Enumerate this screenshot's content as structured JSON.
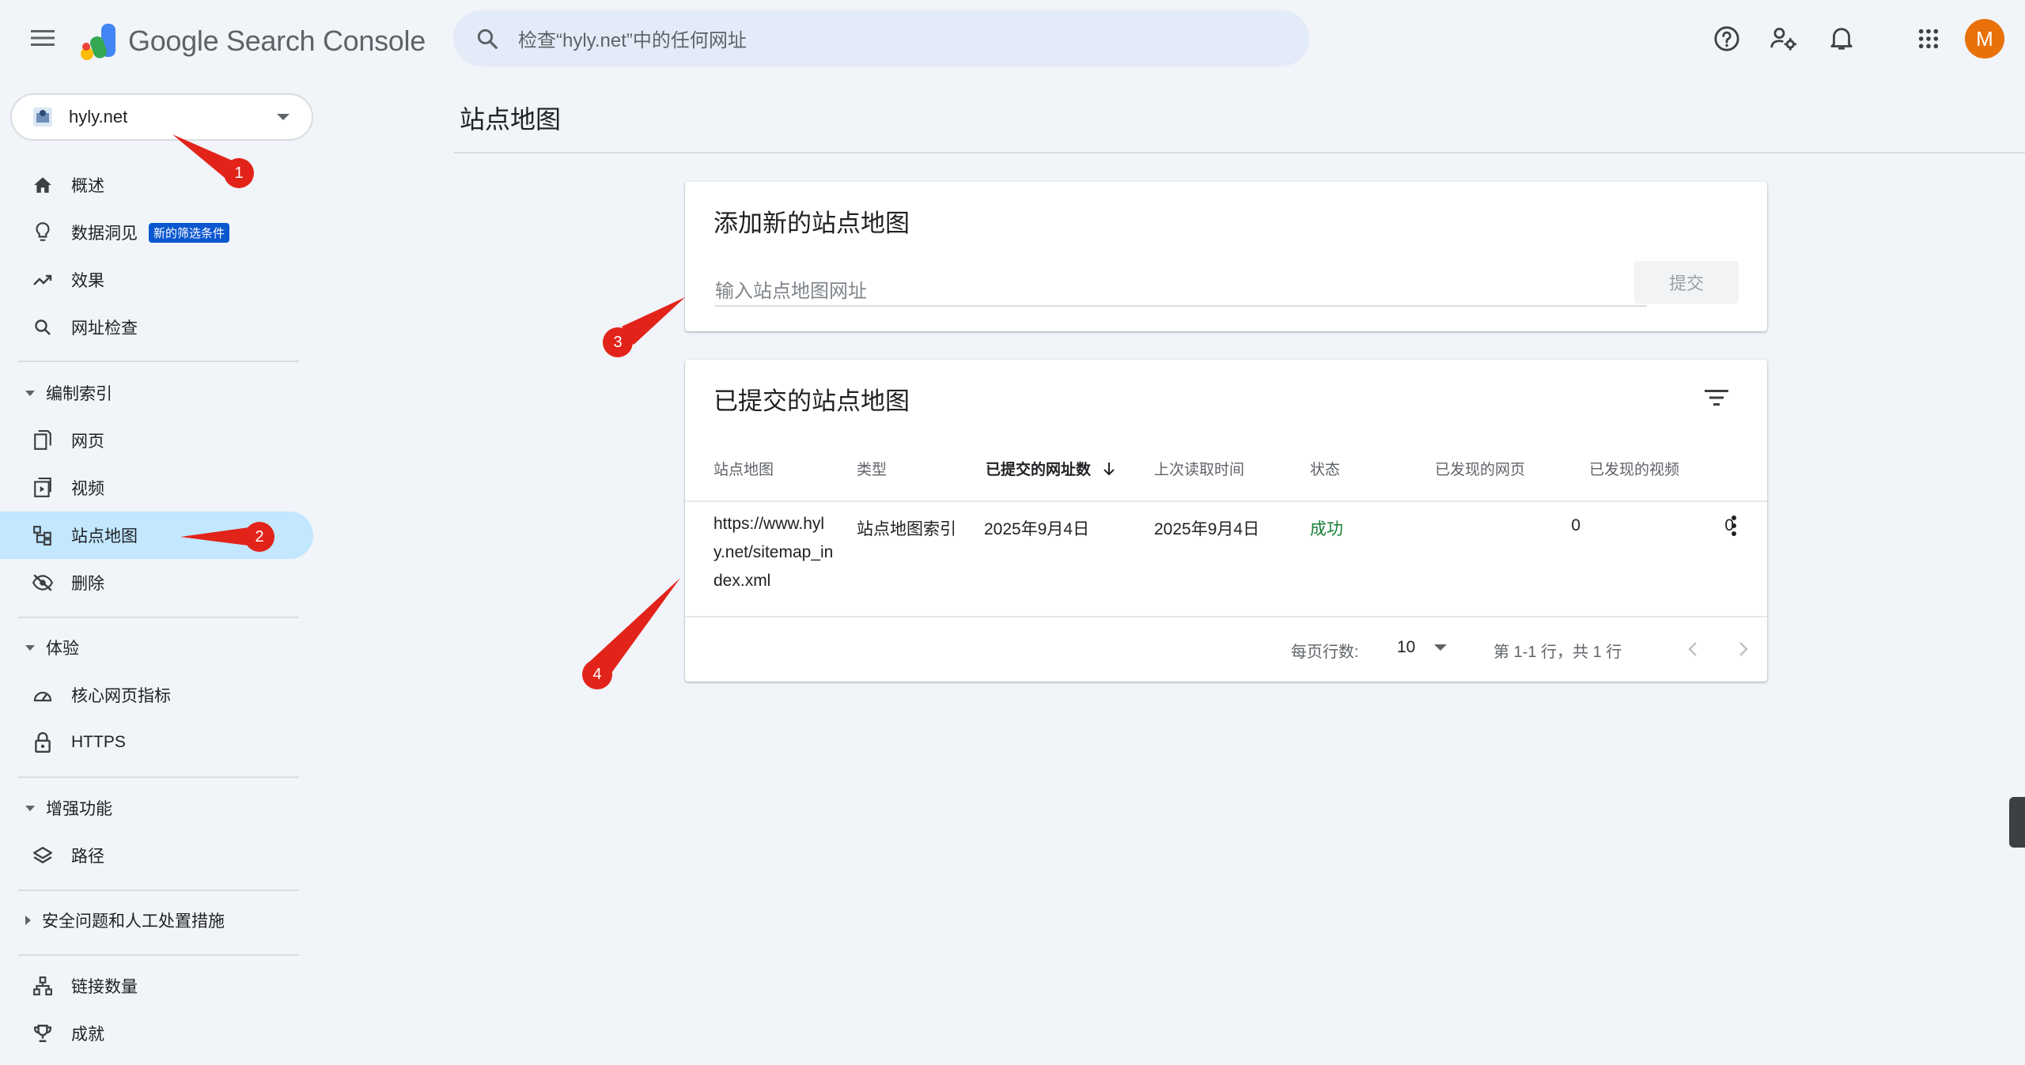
{
  "header": {
    "brand": "Google Search Console",
    "search_placeholder": "检查“hyly.net”中的任何网址",
    "avatar_letter": "M",
    "avatar_color": "#e8710a"
  },
  "sidebar": {
    "property": "hyly.net",
    "items": [
      {
        "label": "概述",
        "icon": "home-icon"
      },
      {
        "label": "数据洞见",
        "icon": "lightbulb-icon",
        "badge": "新的筛选条件"
      },
      {
        "label": "效果",
        "icon": "trending-up-icon"
      },
      {
        "label": "网址检查",
        "icon": "search-icon"
      }
    ],
    "sections": [
      {
        "title": "编制索引",
        "expanded": true,
        "items": [
          {
            "label": "网页",
            "icon": "pages-icon"
          },
          {
            "label": "视频",
            "icon": "video-icon"
          },
          {
            "label": "站点地图",
            "icon": "sitemap-icon",
            "active": true
          },
          {
            "label": "删除",
            "icon": "eye-off-icon"
          }
        ]
      },
      {
        "title": "体验",
        "expanded": true,
        "items": [
          {
            "label": "核心网页指标",
            "icon": "speed-icon"
          },
          {
            "label": "HTTPS",
            "icon": "lock-icon"
          }
        ]
      },
      {
        "title": "增强功能",
        "expanded": true,
        "items": [
          {
            "label": "路径",
            "icon": "layers-icon"
          }
        ]
      },
      {
        "title": "安全问题和人工处置措施",
        "expanded": false,
        "items": []
      }
    ],
    "bottom_items": [
      {
        "label": "链接数量",
        "icon": "link-tree-icon"
      },
      {
        "label": "成就",
        "icon": "trophy-icon"
      }
    ],
    "active_color": "#c2e7ff"
  },
  "main": {
    "title": "站点地图",
    "add_card": {
      "title": "添加新的站点地图",
      "input_placeholder": "输入站点地图网址",
      "submit_label": "提交"
    },
    "list_card": {
      "title": "已提交的站点地图",
      "columns": [
        "站点地图",
        "类型",
        "已提交的网址数",
        "上次读取时间",
        "状态",
        "已发现的网页",
        "已发现的视频"
      ],
      "sorted_column": 2,
      "rows": [
        {
          "sitemap": "https://www.hyly.net/sitemap_index.xml",
          "type": "站点地图索引",
          "submitted": "2025年9月4日",
          "last_read": "2025年9月4日",
          "status": "成功",
          "pages": "0",
          "videos": "0"
        }
      ],
      "footer": {
        "rows_per_page_label": "每页行数:",
        "rows_per_page": "10",
        "range": "第 1-1 行，共 1 行"
      }
    }
  },
  "annotations": {
    "markers": [
      "1",
      "2",
      "3",
      "4"
    ],
    "color": "#e2231a"
  }
}
